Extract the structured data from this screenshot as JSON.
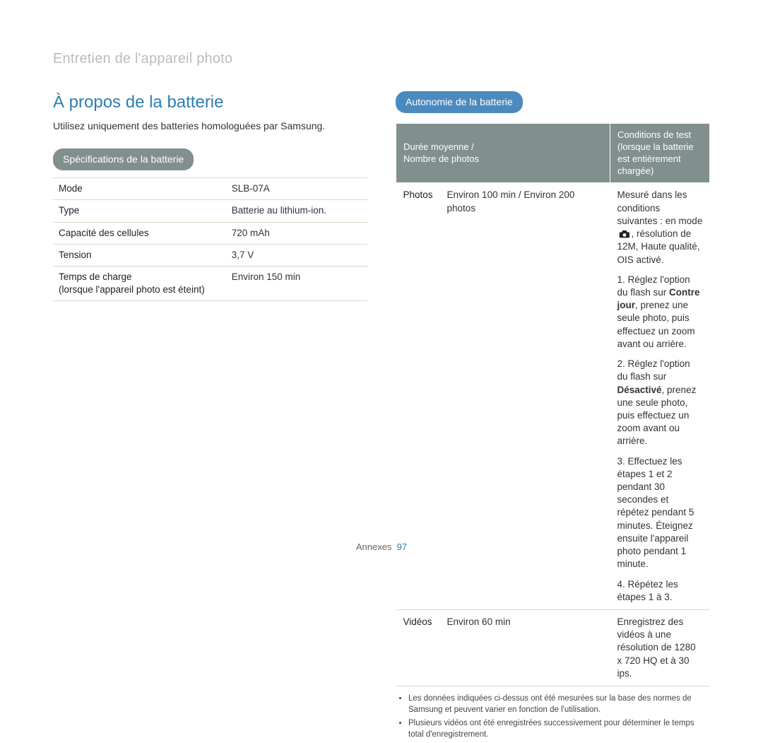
{
  "breadcrumb": "Entretien de l'appareil photo",
  "title": "À propos de la batterie",
  "intro": "Utilisez uniquement des batteries homologuées par Samsung.",
  "spec_heading": "Spécifications de la batterie",
  "spec_rows": [
    {
      "label": "Mode",
      "sub": "",
      "value": "SLB-07A"
    },
    {
      "label": "Type",
      "sub": "",
      "value": "Batterie au lithium-ion."
    },
    {
      "label": "Capacité des cellules",
      "sub": "",
      "value": "720 mAh"
    },
    {
      "label": "Tension",
      "sub": "",
      "value": "3,7 V"
    },
    {
      "label": "Temps de charge",
      "sub": "(lorsque l'appareil photo est éteint)",
      "value": "Environ 150 min"
    }
  ],
  "life_heading": "Autonomie de la batterie",
  "life_header1_line1": "Durée moyenne /",
  "life_header1_line2": "Nombre de photos",
  "life_header2_line1": "Conditions de test (lorsque la batterie",
  "life_header2_line2": "est entièrement chargée)",
  "life_rows": {
    "photos_label": "Photos",
    "photos_value": "Environ 100 min / Environ 200 photos",
    "photos_cond_intro_pre": "Mesuré dans les conditions suivantes : en mode ",
    "photos_cond_intro_post": ", résolution de 12M, Haute qualité, OIS activé.",
    "photos_step1_pre": "1. Réglez l'option du flash sur ",
    "photos_step1_bold": "Contre jour",
    "photos_step1_post": ", prenez une seule photo, puis effectuez un zoom avant ou arrière.",
    "photos_step2_pre": "2. Réglez l'option du flash sur ",
    "photos_step2_bold": "Désactivé",
    "photos_step2_post": ", prenez une seule photo, puis effectuez un zoom avant ou arrière.",
    "photos_step3": "3. Effectuez les étapes 1 et 2 pendant 30 secondes et répétez pendant 5 minutes. Éteignez ensuite l'appareil photo pendant 1 minute.",
    "photos_step4": "4. Répétez les étapes 1 à 3.",
    "videos_label": "Vidéos",
    "videos_value": "Environ 60 min",
    "videos_cond": "Enregistrez des vidéos à une résolution de 1280 x 720 HQ et à 30 ips."
  },
  "notes": [
    "Les données indiquées ci-dessus ont été mesurées sur la base des normes de Samsung et peuvent varier en fonction de l'utilisation.",
    "Plusieurs vidéos ont été enregistrées successivement pour déterminer le temps total d'enregistrement."
  ],
  "footer_label": "Annexes",
  "footer_page": "97"
}
